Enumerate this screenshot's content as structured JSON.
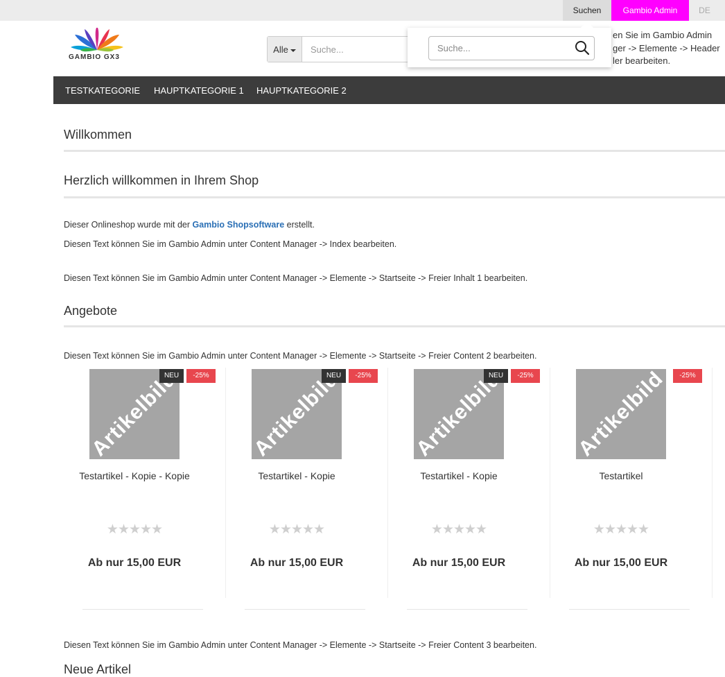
{
  "topbar": {
    "search_label": "Suchen",
    "admin_label": "Gambio Admin",
    "language": "DE",
    "admin_color": "#ff00ff"
  },
  "header": {
    "logo_text": "GAMBIO GX3",
    "category_select": "Alle",
    "search_placeholder": "Suche...",
    "info_lines": [
      "en Sie im Gambio Admin",
      "ger -> Elemente -> Header",
      "ler bearbeiten."
    ]
  },
  "search_dropdown": {
    "placeholder": "Suche...",
    "icon": "search-icon"
  },
  "nav": {
    "items": [
      "TESTKATEGORIE",
      "HAUPTKATEGORIE 1",
      "HAUPTKATEGORIE 2"
    ]
  },
  "content": {
    "welcome_heading": "Willkommen",
    "greeting_heading": "Herzlich willkommen in Ihrem Shop",
    "intro_before": "Dieser Onlineshop wurde mit der ",
    "intro_link": "Gambio Shopsoftware",
    "intro_after": " erstellt.",
    "index_text": "Diesen Text können Sie im Gambio Admin unter Content Manager -> Index bearbeiten.",
    "free_content_1": "Diesen Text können Sie im Gambio Admin unter Content Manager -> Elemente -> Startseite -> Freier Inhalt 1 bearbeiten.",
    "offers_heading": "Angebote",
    "free_content_2": "Diesen Text können Sie im Gambio Admin unter Content Manager -> Elemente -> Startseite -> Freier Content 2 bearbeiten.",
    "free_content_3": "Diesen Text können Sie im Gambio Admin unter Content Manager -> Elemente -> Startseite -> Freier Content 3 bearbeiten.",
    "new_articles_heading": "Neue Artikel"
  },
  "products": [
    {
      "image_text": "Artikelbild",
      "badge_new": "NEU",
      "badge_sale": "-25%",
      "name": "Testartikel - Kopie - Kopie",
      "stars": "★★★★★",
      "price": "Ab nur 15,00 EUR"
    },
    {
      "image_text": "Artikelbild",
      "badge_new": "NEU",
      "badge_sale": "-25%",
      "name": "Testartikel - Kopie",
      "stars": "★★★★★",
      "price": "Ab nur 15,00 EUR"
    },
    {
      "image_text": "Artikelbild",
      "badge_new": "NEU",
      "badge_sale": "-25%",
      "name": "Testartikel - Kopie",
      "stars": "★★★★★",
      "price": "Ab nur 15,00 EUR"
    },
    {
      "image_text": "Artikelbild",
      "badge_sale": "-25%",
      "name": "Testartikel",
      "stars": "★★★★★",
      "price": "Ab nur 15,00 EUR"
    }
  ]
}
